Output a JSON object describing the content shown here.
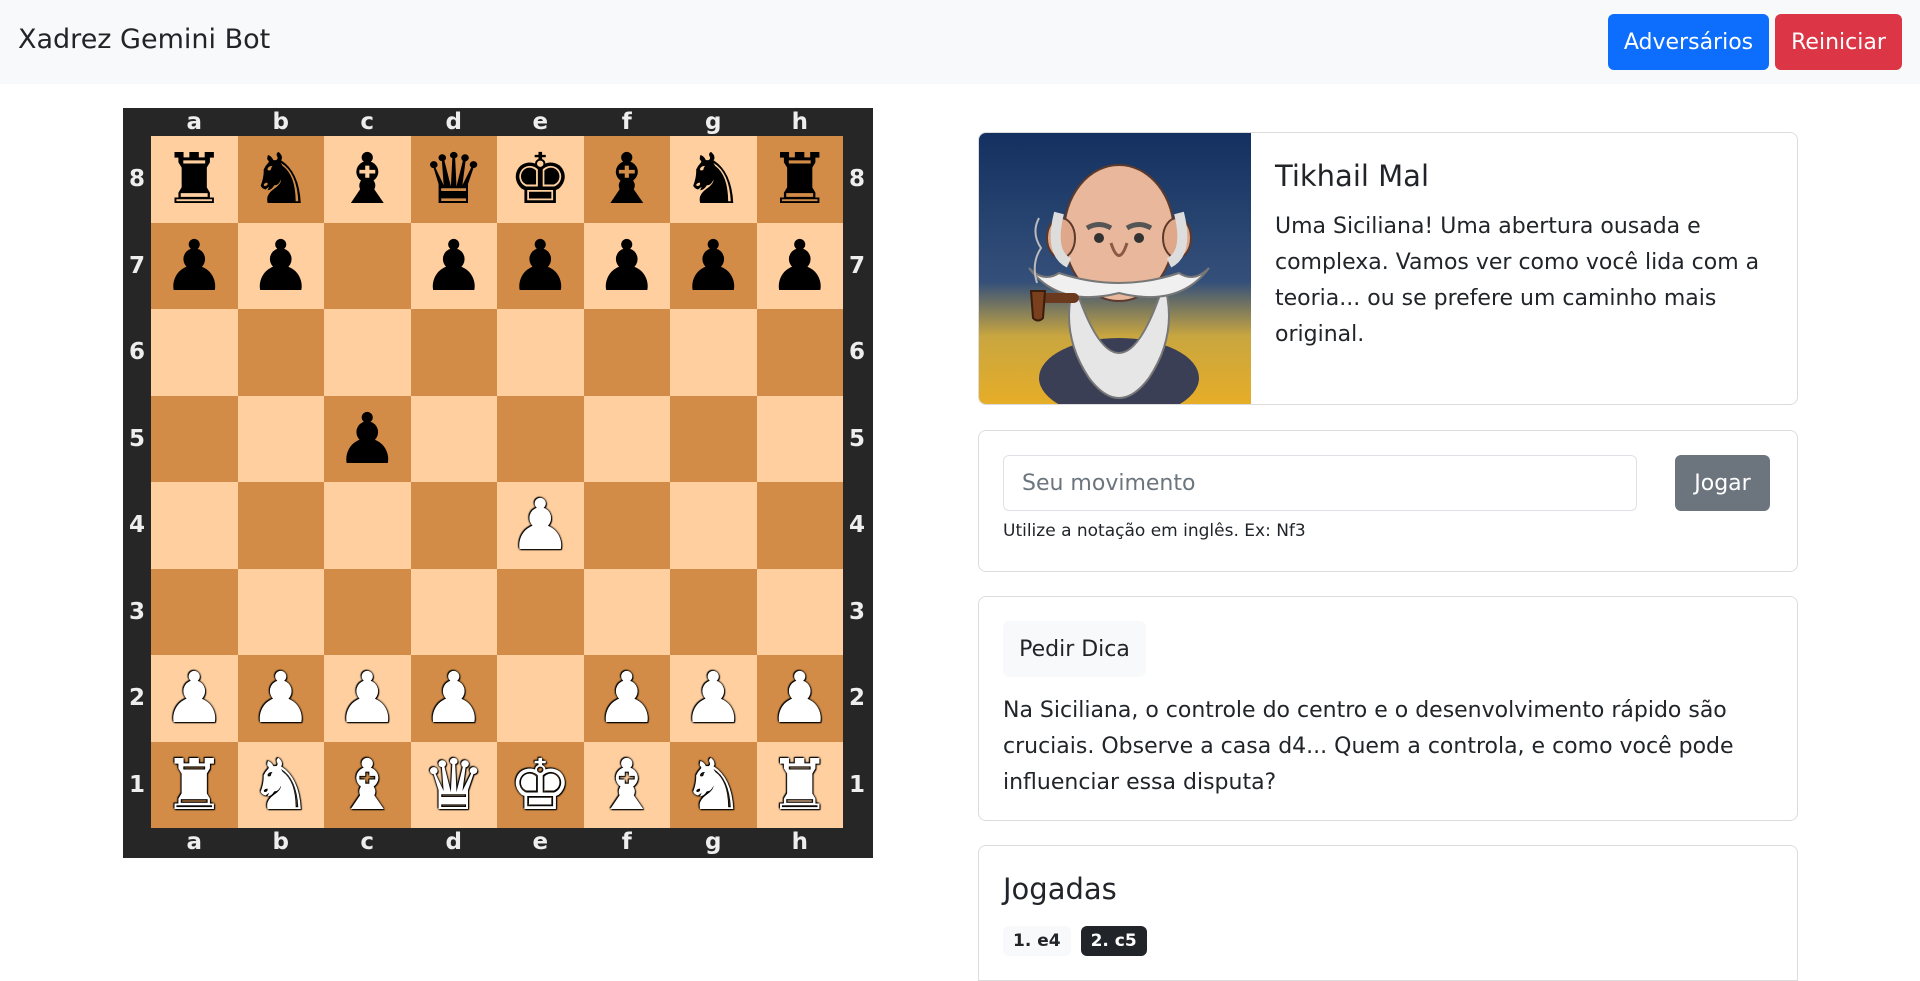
{
  "header": {
    "title": "Xadrez Gemini Bot",
    "opponents_label": "Adversários",
    "reset_label": "Reiniciar"
  },
  "board": {
    "files": [
      "a",
      "b",
      "c",
      "d",
      "e",
      "f",
      "g",
      "h"
    ],
    "ranks": [
      "8",
      "7",
      "6",
      "5",
      "4",
      "3",
      "2",
      "1"
    ],
    "colors": {
      "light": "#ffcf9f",
      "dark": "#d28c47",
      "frame": "#262626"
    },
    "position": [
      [
        "br",
        "bn",
        "bb",
        "bq",
        "bk",
        "bb",
        "bn",
        "br"
      ],
      [
        "bp",
        "bp",
        "",
        "bp",
        "bp",
        "bp",
        "bp",
        "bp"
      ],
      [
        "",
        "",
        "",
        "",
        "",
        "",
        "",
        ""
      ],
      [
        "",
        "",
        "bp",
        "",
        "",
        "",
        "",
        ""
      ],
      [
        "",
        "",
        "",
        "",
        "wp",
        "",
        "",
        ""
      ],
      [
        "",
        "",
        "",
        "",
        "",
        "",
        "",
        ""
      ],
      [
        "wp",
        "wp",
        "wp",
        "wp",
        "",
        "wp",
        "wp",
        "wp"
      ],
      [
        "wr",
        "wn",
        "wb",
        "wq",
        "wk",
        "wb",
        "wn",
        "wr"
      ]
    ]
  },
  "bot": {
    "name": "Tikhail Mal",
    "message": "Uma Siciliana! Uma abertura ousada e complexa. Vamos ver como você lida com a teoria... ou se prefere um caminho mais original."
  },
  "move": {
    "placeholder": "Seu movimento",
    "value": "",
    "play_label": "Jogar",
    "help": "Utilize a notação em inglês. Ex: Nf3"
  },
  "hint": {
    "button_label": "Pedir Dica",
    "text": "Na Siciliana, o controle do centro e o desenvolvimento rápido são cruciais. Observe a casa d4... Quem a controla, e como você pode influenciar essa disputa?"
  },
  "moves": {
    "title": "Jogadas",
    "items": [
      {
        "label": "1. e4",
        "style": "light"
      },
      {
        "label": "2. c5",
        "style": "dark"
      }
    ]
  }
}
